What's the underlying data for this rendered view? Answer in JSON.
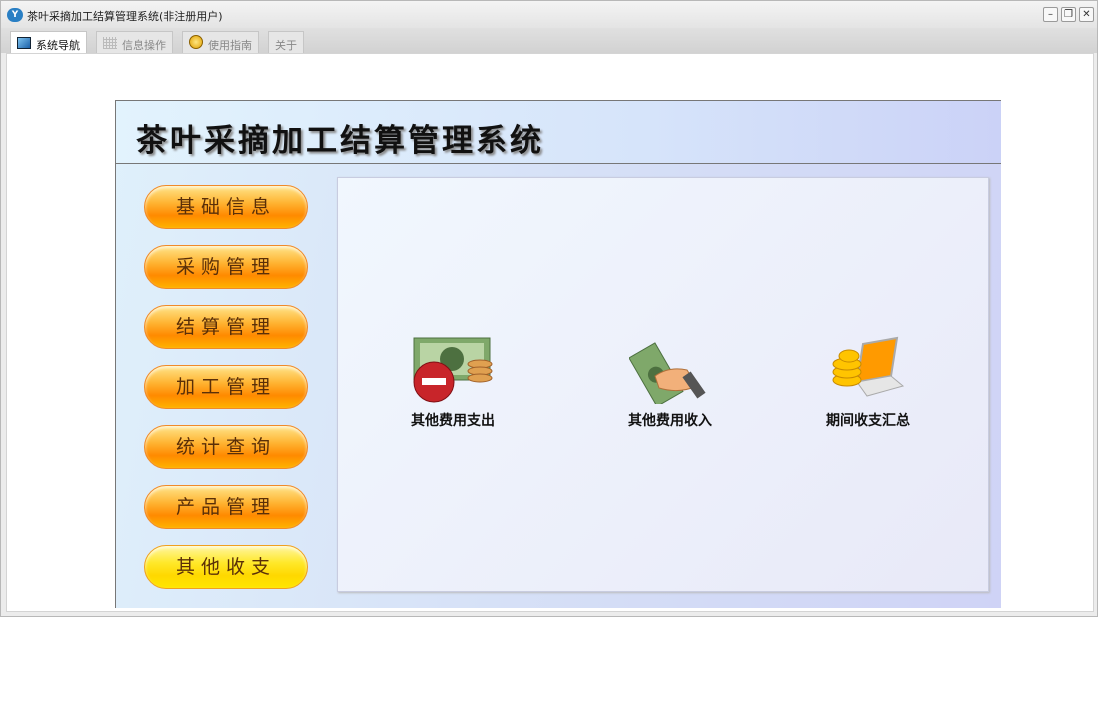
{
  "window": {
    "title": "茶叶采摘加工结算管理系统(非注册用户)",
    "app_icon": "Y"
  },
  "tabs": [
    {
      "label": "系统导航",
      "icon": "monitor-icon",
      "active": true
    },
    {
      "label": "信息操作",
      "icon": "grid-icon"
    },
    {
      "label": "使用指南",
      "icon": "help-icon"
    },
    {
      "label": "关于"
    }
  ],
  "header": {
    "title": "茶叶采摘加工结算管理系统"
  },
  "nav": [
    "基础信息",
    "采购管理",
    "结算管理",
    "加工管理",
    "统计查询",
    "产品管理",
    "其他收支"
  ],
  "nav_selected": "其他收支",
  "items": [
    {
      "label": "其他费用支出",
      "icon": "money-minus-icon"
    },
    {
      "label": "其他费用收入",
      "icon": "hand-money-icon"
    },
    {
      "label": "期间收支汇总",
      "icon": "coins-laptop-icon"
    }
  ]
}
